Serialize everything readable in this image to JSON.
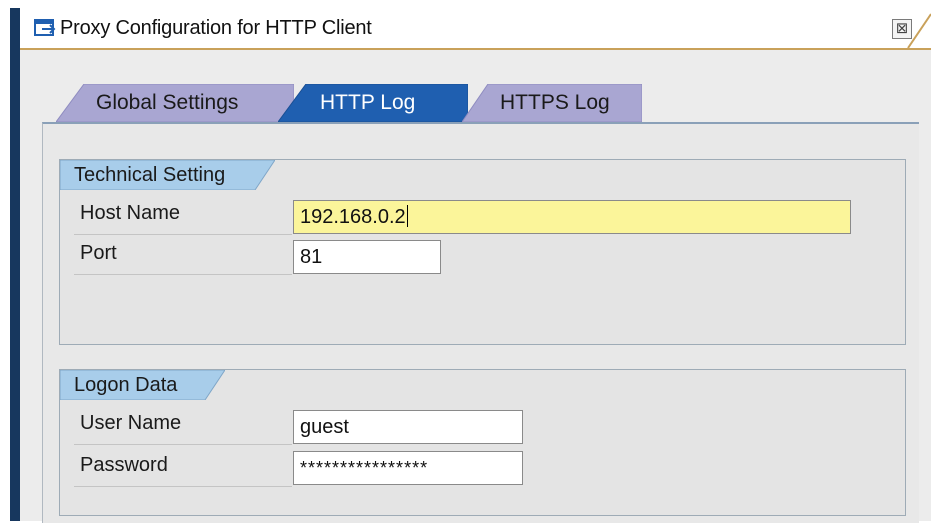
{
  "window": {
    "title": "Proxy Configuration for HTTP Client",
    "close_symbol": "⊠"
  },
  "tabs": [
    {
      "label": "Global Settings",
      "active": false
    },
    {
      "label": "HTTP Log",
      "active": true
    },
    {
      "label": "HTTPS Log",
      "active": false
    }
  ],
  "technical_setting": {
    "header": "Technical Setting",
    "host_name_label": "Host Name",
    "host_name_value": "192.168.0.2",
    "port_label": "Port",
    "port_value": "81"
  },
  "logon_data": {
    "header": "Logon Data",
    "user_name_label": "User Name",
    "user_name_value": "guest",
    "password_label": "Password",
    "password_value": "****************"
  },
  "colors": {
    "active_tab": "#1f5fb0",
    "inactive_tab": "#a9a6d2",
    "focused_field": "#fbf59a",
    "group_header": "#a8cdea",
    "window_edge": "#17375e"
  }
}
